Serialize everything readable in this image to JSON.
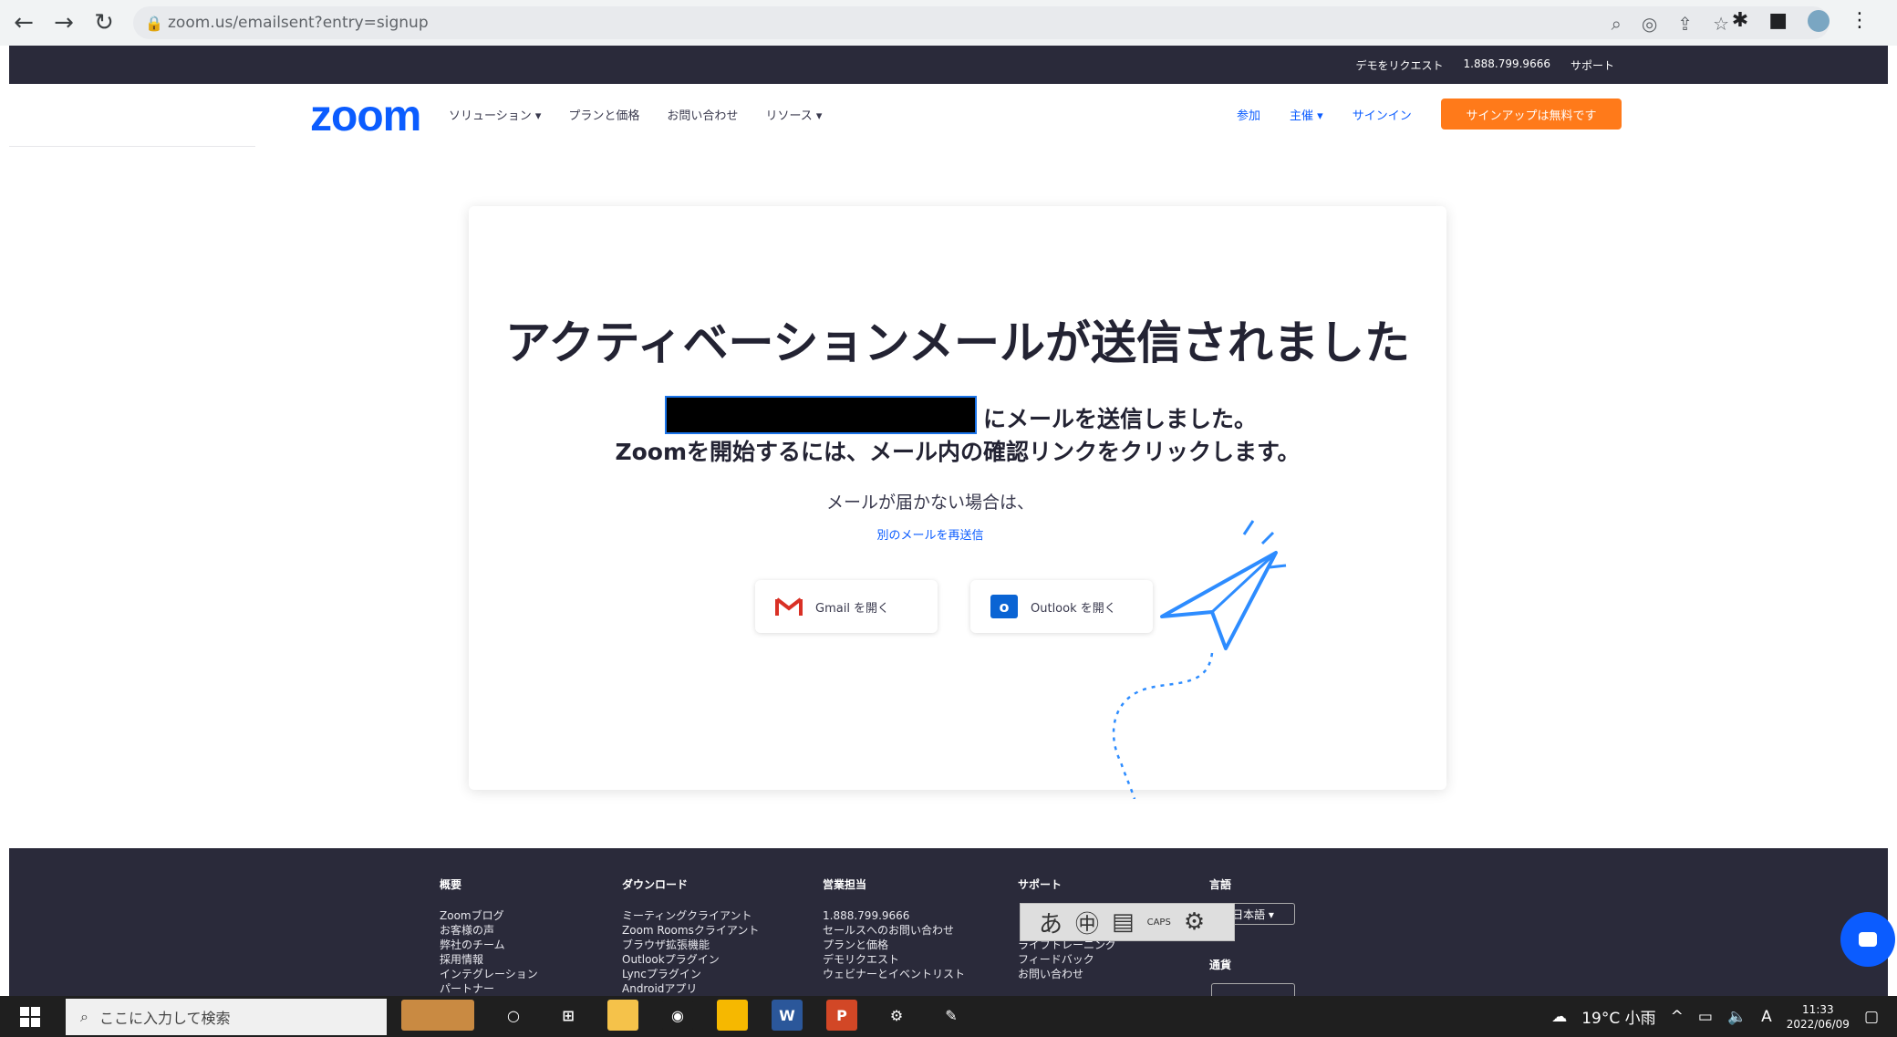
{
  "browser": {
    "url": "zoom.us/emailsent?entry=signup"
  },
  "utilbar": {
    "links": [
      "デモをリクエスト",
      "1.888.799.9666",
      "サポート"
    ]
  },
  "nav": {
    "logo": "zoom",
    "left_items": [
      "ソリューション ▾",
      "プランと価格",
      "お問い合わせ",
      "リソース ▾"
    ],
    "right_items": [
      "参加",
      "主催 ▾",
      "サインイン"
    ],
    "signup": "サインアップは無料です"
  },
  "card": {
    "title": "アクティベーションメールが送信されました",
    "sent": "にメールを送信しました。",
    "click": "Zoomを開始するには、メール内の確認リンクをクリックします。",
    "not_received": "メールが届かない場合は、",
    "resend": "別のメールを再送信",
    "gmail": "Gmail を開く",
    "outlook": "Outlook を開く"
  },
  "footer": {
    "col1": {
      "heading": "概要",
      "items": [
        "Zoomブログ",
        "お客様の声",
        "弊社のチーム",
        "採用情報",
        "インテグレーション",
        "パートナー"
      ]
    },
    "col2": {
      "heading": "ダウンロード",
      "items": [
        "ミーティングクライアント",
        "Zoom Roomsクライアント",
        "ブラウザ拡張機能",
        "Outlookプラグイン",
        "Lyncプラグイン",
        "Androidアプリ"
      ]
    },
    "col3": {
      "heading": "営業担当",
      "items": [
        "1.888.799.9666",
        "セールスへのお問い合わせ",
        "プランと価格",
        "デモリクエスト",
        "ウェビナーとイベントリスト"
      ]
    },
    "col4": {
      "heading": "サポート",
      "items": [
        "",
        "",
        "ライブトレーニング",
        "フィードバック",
        "お問い合わせ"
      ]
    },
    "col5": {
      "heading": "言語",
      "lang": "日本語 ▾",
      "heading2": "通貨"
    }
  },
  "ime": {
    "items": [
      "あ",
      "㊥",
      "▤",
      "CAPS",
      "⚙"
    ]
  },
  "taskbar": {
    "search_placeholder": "ここに入力して検索",
    "weather": "19°C 小雨",
    "ime_letter": "A",
    "time": "11:33",
    "date": "2022/06/09"
  }
}
